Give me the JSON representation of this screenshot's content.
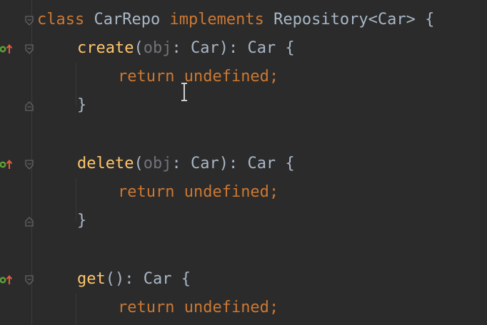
{
  "editor": {
    "lines": [
      {
        "parts": [
          {
            "t": "class ",
            "c": "kw"
          },
          {
            "t": "CarRepo ",
            "c": "cls"
          },
          {
            "t": "implements ",
            "c": "kw"
          },
          {
            "t": "Repository<Car> {",
            "c": "plain"
          }
        ]
      },
      {
        "parts": [
          {
            "t": "create",
            "c": "fn"
          },
          {
            "t": "(",
            "c": "punct"
          },
          {
            "t": "obj",
            "c": "param"
          },
          {
            "t": ": Car): Car {",
            "c": "plain"
          }
        ]
      },
      {
        "parts": [
          {
            "t": "return ",
            "c": "kw"
          },
          {
            "t": "undefined",
            "c": "kw"
          },
          {
            "t": ";",
            "c": "kw"
          }
        ]
      },
      {
        "parts": [
          {
            "t": "}",
            "c": "plain"
          }
        ]
      },
      {
        "parts": []
      },
      {
        "parts": [
          {
            "t": "delete",
            "c": "fn"
          },
          {
            "t": "(",
            "c": "punct"
          },
          {
            "t": "obj",
            "c": "param"
          },
          {
            "t": ": Car): Car {",
            "c": "plain"
          }
        ]
      },
      {
        "parts": [
          {
            "t": "return ",
            "c": "kw"
          },
          {
            "t": "undefined",
            "c": "kw"
          },
          {
            "t": ";",
            "c": "kw"
          }
        ]
      },
      {
        "parts": [
          {
            "t": "}",
            "c": "plain"
          }
        ]
      },
      {
        "parts": []
      },
      {
        "parts": [
          {
            "t": "get",
            "c": "fn"
          },
          {
            "t": "(): Car {",
            "c": "plain"
          }
        ]
      },
      {
        "parts": [
          {
            "t": "return ",
            "c": "kw"
          },
          {
            "t": "undefined",
            "c": "kw"
          },
          {
            "t": ";",
            "c": "kw"
          }
        ]
      }
    ]
  },
  "gutter": {
    "icons": [
      "fold-open-icon",
      "implements-method-icon",
      "fold-end-icon"
    ]
  }
}
